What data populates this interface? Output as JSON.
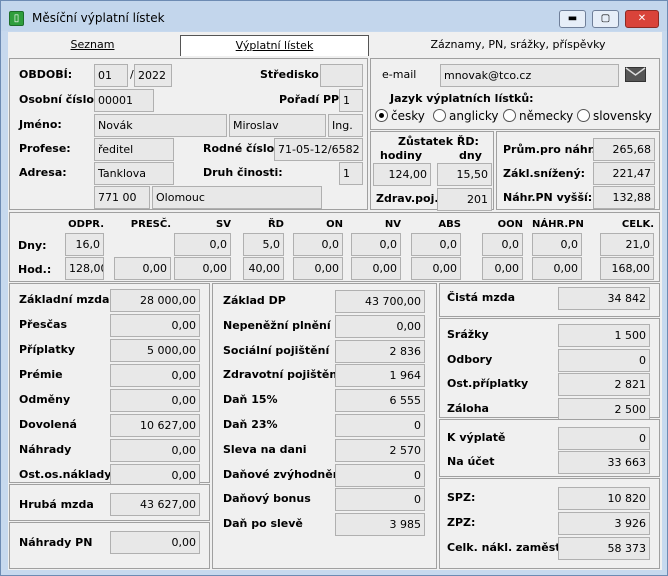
{
  "window": {
    "title": "Měsíční výplatní lístek",
    "buttons": {
      "minimize": "▬",
      "maximize": "▢",
      "close": "✕"
    },
    "icon": "app-icon"
  },
  "tabs": [
    "Seznam",
    "Výplatní lístek",
    "Záznamy, PN, srážky, příspěvky"
  ],
  "header": {
    "obdobi_label": "OBDOBÍ:",
    "month": "01",
    "sep": "/",
    "year": "2022",
    "stredisko_label": "Středisko:",
    "stredisko": "",
    "osobni_label": "Osobní číslo:",
    "osobni": "00001",
    "poradi_label": "Pořadí PP:",
    "poradi": "1",
    "jmeno_label": "Jméno:",
    "prijmeni": "Novák",
    "jmeno": "Miroslav",
    "titul": "Ing.",
    "profese_label": "Profese:",
    "profese": "ředitel",
    "rodne_label": "Rodné číslo:",
    "rodne": "71-05-12/6582",
    "adresa_label": "Adresa:",
    "ulice": "Tanklova",
    "druh_label": "Druh činosti:",
    "druh": "1",
    "psc": "771 00",
    "mesto": "Olomouc"
  },
  "email": {
    "label": "e-mail",
    "value": "mnovak@tco.cz",
    "icon": "envelope-icon"
  },
  "jazyk": {
    "label": "Jazyk výplatních lístků:",
    "options": [
      "česky",
      "anglicky",
      "německy",
      "slovensky"
    ],
    "selected": 0
  },
  "zustatek": {
    "label": "Zůstatek ŘD:",
    "hodiny_label": "hodiny",
    "dny_label": "dny",
    "hodiny": "124,00",
    "dny": "15,50",
    "zdrav_label": "Zdrav.poj.:",
    "zdrav": "201"
  },
  "prumer": {
    "label": "Prům.pro náhr.:",
    "value": "265,68",
    "zakl_label": "Zákl.snížený:",
    "zakl": "221,47",
    "nahr_label": "Náhr.PN vyšší:",
    "nahr": "132,88"
  },
  "hours": {
    "headers": [
      "ODPR.",
      "PRESČ.",
      "SV",
      "ŘD",
      "ON",
      "NV",
      "ABS",
      "OON",
      "NÁHR.PN",
      "CELK."
    ],
    "dny_label": "Dny:",
    "dny": [
      "16,0",
      "",
      "0,0",
      "5,0",
      "0,0",
      "0,0",
      "0,0",
      "0,0",
      "0,0",
      "21,0"
    ],
    "hod_label": "Hod.:",
    "hod": [
      "128,00",
      "0,00",
      "0,00",
      "40,00",
      "0,00",
      "0,00",
      "0,00",
      "0,00",
      "0,00",
      "168,00"
    ]
  },
  "col1": [
    {
      "label": "Základní mzda",
      "value": "28 000,00"
    },
    {
      "label": "Přesčas",
      "value": "0,00"
    },
    {
      "label": "Příplatky",
      "value": "5 000,00"
    },
    {
      "label": "Prémie",
      "value": "0,00"
    },
    {
      "label": "Odměny",
      "value": "0,00"
    },
    {
      "label": "Dovolená",
      "value": "10 627,00"
    },
    {
      "label": "Náhrady",
      "value": "0,00"
    },
    {
      "label": "Ost.os.náklady",
      "value": "0,00"
    }
  ],
  "hruba": {
    "label": "Hrubá mzda",
    "value": "43 627,00"
  },
  "nahradypn": {
    "label": "Náhrady PN",
    "value": "0,00"
  },
  "col2": [
    {
      "label": "Základ DP",
      "value": "43 700,00"
    },
    {
      "label": "Nepeněžní plnění",
      "value": "0,00"
    },
    {
      "label": "Sociální pojištění",
      "value": "2 836"
    },
    {
      "label": "Zdravotní pojištění",
      "value": "1 964"
    },
    {
      "label": "Daň 15%",
      "value": "6 555"
    },
    {
      "label": "Daň 23%",
      "value": "0"
    },
    {
      "label": "Sleva na dani",
      "value": "2 570"
    },
    {
      "label": "Daňové zvýhodnění",
      "value": "0"
    },
    {
      "label": "Daňový bonus",
      "value": "0"
    },
    {
      "label": "Daň po slevě",
      "value": "3 985"
    }
  ],
  "col3": {
    "cista": {
      "label": "Čistá mzda",
      "value": "34 842"
    },
    "srazky": [
      {
        "label": "Srážky",
        "value": "1 500"
      },
      {
        "label": "Odbory",
        "value": "0"
      },
      {
        "label": "Ost.příplatky",
        "value": "2 821"
      },
      {
        "label": "Záloha",
        "value": "2 500"
      }
    ],
    "vyplata": [
      {
        "label": "K výplatě",
        "value": "0"
      },
      {
        "label": "Na účet",
        "value": "33 663"
      }
    ],
    "naklady": [
      {
        "label": "SPZ:",
        "value": "10 820"
      },
      {
        "label": "ZPZ:",
        "value": "3 926"
      },
      {
        "label": "Celk. nákl. zaměst.:",
        "value": "58 373"
      }
    ]
  }
}
